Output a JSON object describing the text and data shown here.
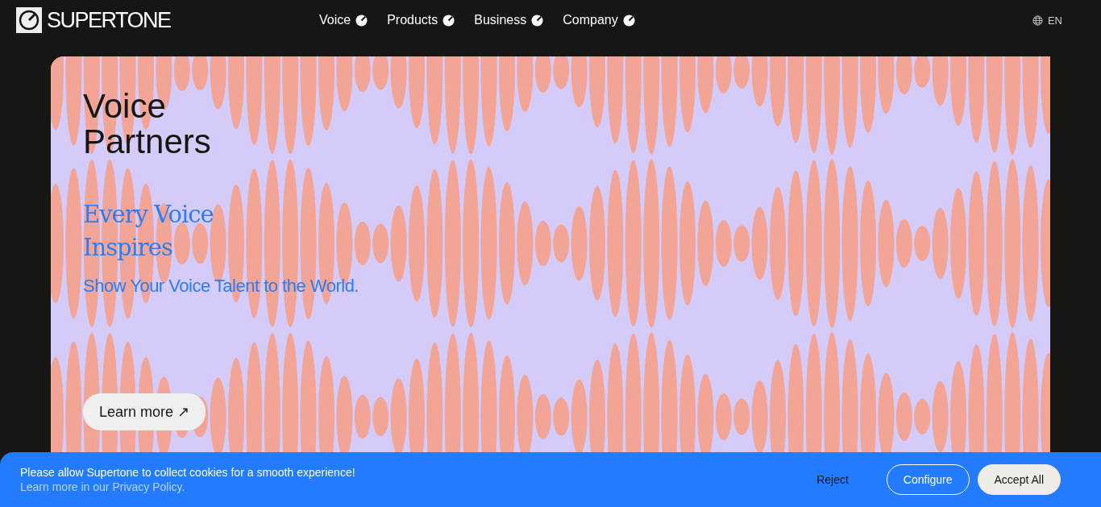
{
  "header": {
    "logo": "SUPERTONE",
    "nav": [
      "Voice",
      "Products",
      "Business",
      "Company"
    ],
    "language": "EN"
  },
  "hero": {
    "title": "Voice\nPartners",
    "tagline": "Every Voice\nInspires",
    "subtitle": "Show Your Voice Talent to the World.",
    "button": "Learn more ↗"
  },
  "cookie_banner": {
    "message": "Please allow Supertone to collect cookies for a smooth experience!",
    "link": "Learn more in our Privacy Policy.",
    "buttons": [
      {
        "label": "Reject",
        "kind": "text"
      },
      {
        "label": "Configure",
        "kind": "outline"
      },
      {
        "label": "Accept All",
        "kind": "filled"
      }
    ]
  }
}
